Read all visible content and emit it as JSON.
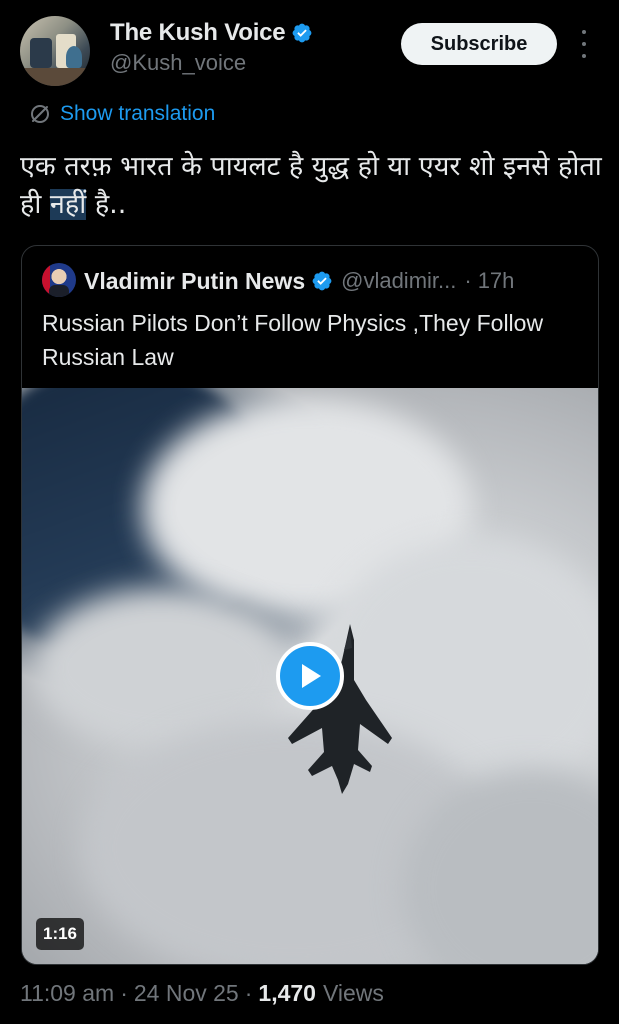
{
  "tweet": {
    "author": {
      "display_name": "The Kush Voice",
      "handle": "@Kush_voice",
      "verified": true
    },
    "subscribe_label": "Subscribe",
    "translate_label": "Show translation",
    "text_part1": "एक तरफ़ भारत के पायलट है युद्ध हो या एयर शो इनसे होता ही ",
    "text_highlight": "नहीं",
    "text_part2": " है..",
    "quote": {
      "display_name": "Vladimir Putin News",
      "handle": "@vladimir...",
      "dot": "·",
      "time": "17h",
      "text": "Russian Pilots Don’t Follow Physics ,They Follow Russian Law",
      "video_duration": "1:16"
    },
    "meta": {
      "time": "11:09 am",
      "dot1": "·",
      "date": "24 Nov 25",
      "dot2": "·",
      "views_count": "1,470",
      "views_label": "Views"
    }
  },
  "colors": {
    "accent": "#1d9bf0",
    "secondary_text": "#71767b",
    "primary_text": "#e7e9ea",
    "background": "#000000"
  },
  "icons": {
    "verified": "verified-badge-icon",
    "translate": "translate-icon",
    "more": "more-vertical-icon",
    "play": "play-icon"
  }
}
